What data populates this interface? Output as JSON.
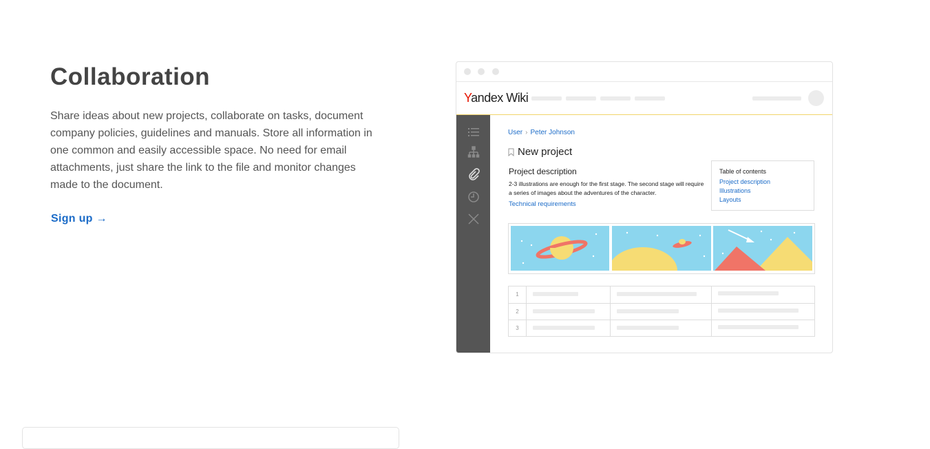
{
  "section": {
    "title": "Collaboration",
    "description": "Share ideas about new projects, collaborate on tasks, document company policies, guidelines and manuals. Store all information in one common and easily accessible space. No need for email attachments, just share the link to the file and monitor changes made to the document.",
    "signup_label": "Sign up →"
  },
  "mockup": {
    "logo_prefix": "Y",
    "logo_rest": "andex",
    "logo_product": "Wiki",
    "breadcrumb": [
      "User",
      "Peter Johnson"
    ],
    "breadcrumb_sep": "›",
    "page_title": "New project",
    "description_title": "Project description",
    "description_text": "2-3 illustrations are enough for the first stage. The second stage will require a series of images about the adventures of the character.",
    "description_link": "Technical requirements",
    "toc": {
      "title": "Table of contents",
      "items": [
        "Project description",
        "Illustrations",
        "Layouts"
      ]
    },
    "table_rows": [
      "1",
      "2",
      "3"
    ],
    "sidebar_icons": [
      "list-icon",
      "sitemap-icon",
      "attachment-icon",
      "clock-icon",
      "close-icon"
    ]
  },
  "colors": {
    "accent": "#1c6cc8",
    "sidebar": "#555555",
    "logo_red": "#e61400",
    "sky": "#8cd6ee",
    "planet_yellow": "#f6dc74",
    "ring_red": "#f07467"
  }
}
